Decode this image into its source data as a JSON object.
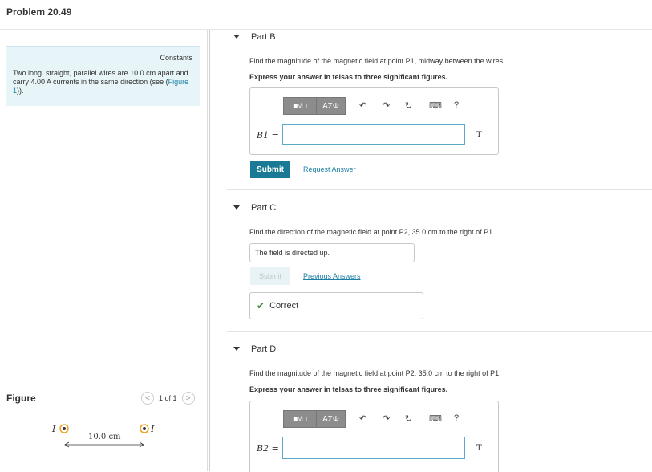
{
  "header": {
    "title": "Problem 20.49"
  },
  "problem": {
    "constants_link": "Constants",
    "text_before_link": "Two long, straight, parallel wires are 10.0 cm apart and carry 4.00 A currents in the same direction (see (",
    "figure_link": "Figure 1",
    "text_after_link": "))."
  },
  "figure": {
    "label": "Figure",
    "pager": "1 of 1",
    "prev_glyph": "<",
    "next_glyph": ">",
    "current_label_left": "I",
    "current_label_right": "I",
    "distance_label": "10.0 cm"
  },
  "toolbar": {
    "templates_label": "■√□",
    "greek_label": "AΣΦ",
    "undo_glyph": "↶",
    "redo_glyph": "↷",
    "reset_glyph": "↻",
    "keyboard_glyph": "⌨",
    "help_glyph": "?"
  },
  "partB": {
    "label": "Part B",
    "question": "Find the magnitude of the magnetic field at point P1, midway between the wires.",
    "instruction": "Express your answer in telsas to three significant figures.",
    "var_label": "B1 =",
    "unit": "T",
    "input_value": "",
    "submit_label": "Submit",
    "request_label": "Request Answer"
  },
  "partC": {
    "label": "Part C",
    "question": "Find the direction of the magnetic field at point P2, 35.0 cm to the right of P1.",
    "answer_value": "The field is directed up.",
    "submit_label": "Submit",
    "previous_label": "Previous Answers",
    "status_label": "Correct",
    "status_color": "#3a8a3a"
  },
  "partD": {
    "label": "Part D",
    "question": "Find the magnitude of the magnetic field at point P2, 35.0 cm to the right of P1.",
    "instruction": "Express your answer in telsas to three significant figures.",
    "var_label": "B2 =",
    "unit": "T",
    "input_value": ""
  },
  "colors": {
    "accent": "#1a7a96",
    "link": "#1c7fa6",
    "constants_bg": "#e7f4f8",
    "figure_orange": "#f0a020"
  }
}
